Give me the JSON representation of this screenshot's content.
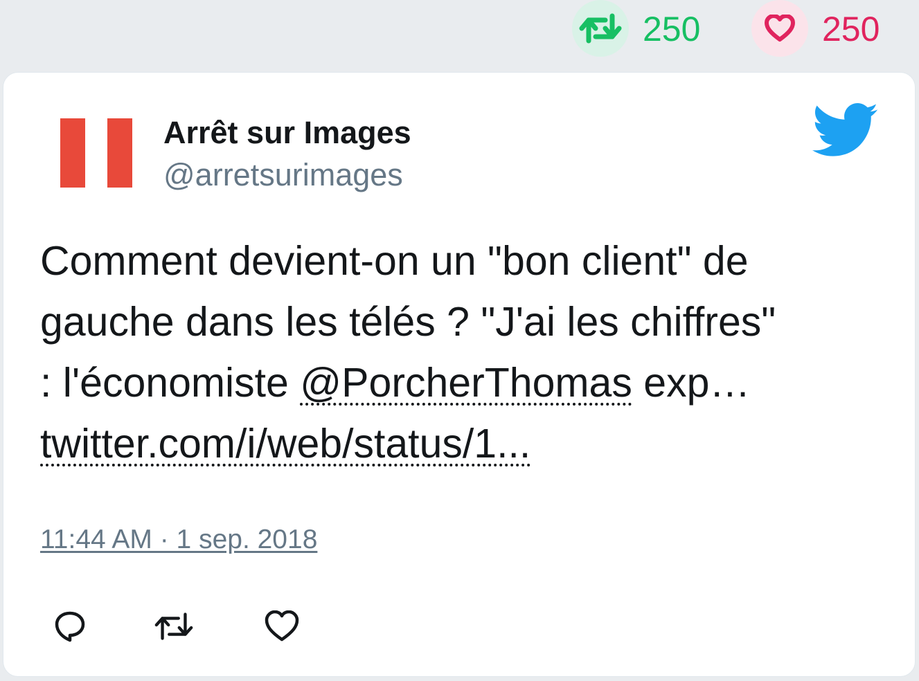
{
  "stats": {
    "retweet_count": "250",
    "like_count": "250",
    "retweet_icon": "retweet-icon",
    "like_icon": "heart-icon"
  },
  "tweet": {
    "author_name": "Arrêt sur Images",
    "author_handle": "@arretsurimages",
    "text_line1": "Comment devient-on un \"bon client\" de",
    "text_line2": "gauche dans les télés ? \"J'ai les chiffres\"",
    "text_line3_prefix": ": l'économiste ",
    "mention": "@PorcherThomas",
    "text_line3_suffix": " exp…",
    "link": "twitter.com/i/web/status/1...",
    "timestamp": "11:44 AM · 1 sep. 2018"
  },
  "colors": {
    "retweet_green": "#17bf63",
    "like_pink": "#e0245e",
    "twitter_blue": "#1da1f2",
    "avatar_red": "#e8493a",
    "secondary_text": "#657786"
  },
  "icons": {
    "brand": "twitter-bird-icon",
    "reply": "reply-icon",
    "retweet": "retweet-icon",
    "like": "heart-icon"
  }
}
